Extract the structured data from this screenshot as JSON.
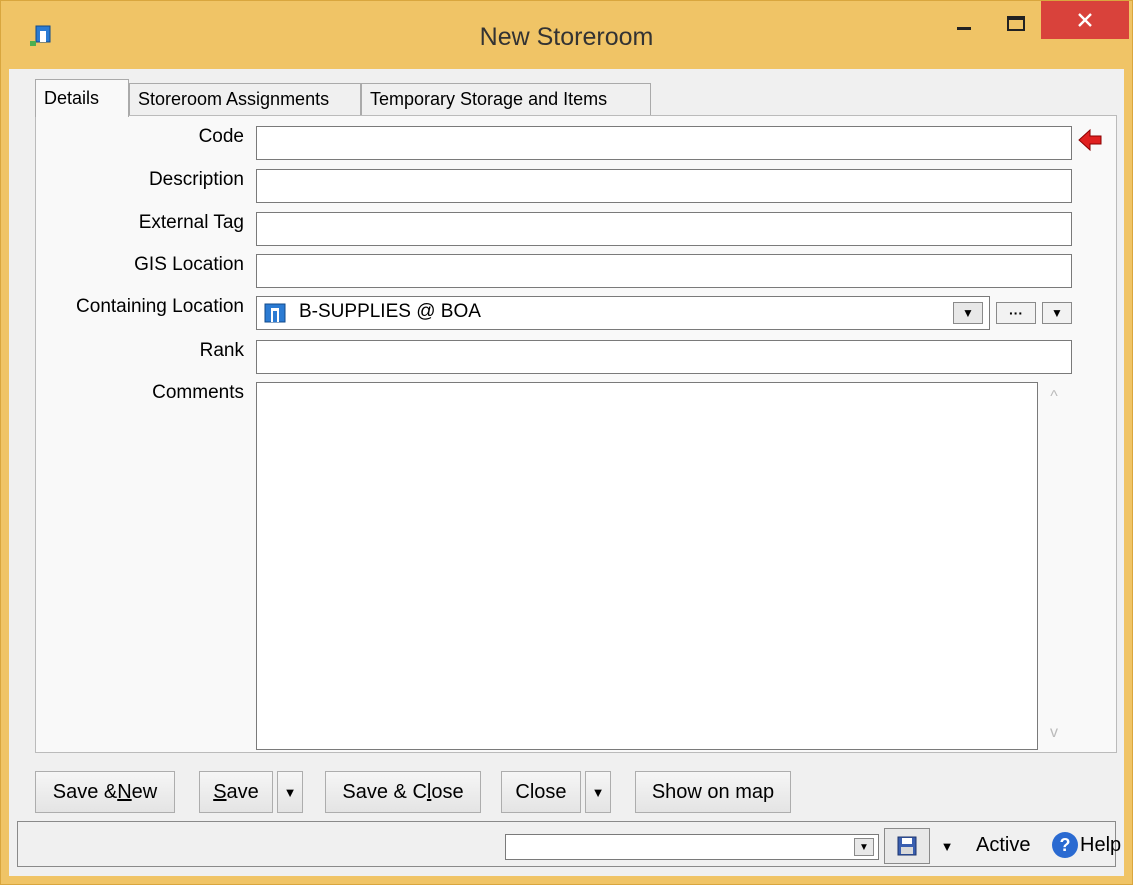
{
  "window": {
    "title": "New Storeroom",
    "minimize_icon": "minimize-icon",
    "maximize_icon": "maximize-icon",
    "close_icon": "close-icon"
  },
  "tabs": [
    {
      "label": "Details",
      "active": true
    },
    {
      "label": "Storeroom Assignments",
      "active": false
    },
    {
      "label": "Temporary Storage and Items",
      "active": false
    }
  ],
  "form": {
    "code_label": "Code",
    "code_value": "",
    "description_label": "Description",
    "description_value": "",
    "external_tag_label": "External Tag",
    "external_tag_value": "",
    "gis_location_label": "GIS Location",
    "gis_location_value": "",
    "containing_location_label": "Containing Location",
    "containing_location_value": "B-SUPPLIES @ BOA",
    "rank_label": "Rank",
    "rank_value": "",
    "comments_label": "Comments",
    "comments_value": "",
    "ellipsis_label": "···"
  },
  "buttons": {
    "save_new": {
      "pre": "Save & ",
      "accel": "N",
      "post": "ew"
    },
    "save": {
      "pre": "",
      "accel": "S",
      "post": "ave"
    },
    "save_close": {
      "pre": "Save & C",
      "accel": "l",
      "post": "ose"
    },
    "close": "Close",
    "show_on_map": "Show on map"
  },
  "status": {
    "combo_value": "",
    "state": "Active",
    "help": "Help"
  },
  "colors": {
    "title_bar": "#f0c466",
    "close_button": "#d9423b",
    "required_arrow": "#e02020"
  }
}
